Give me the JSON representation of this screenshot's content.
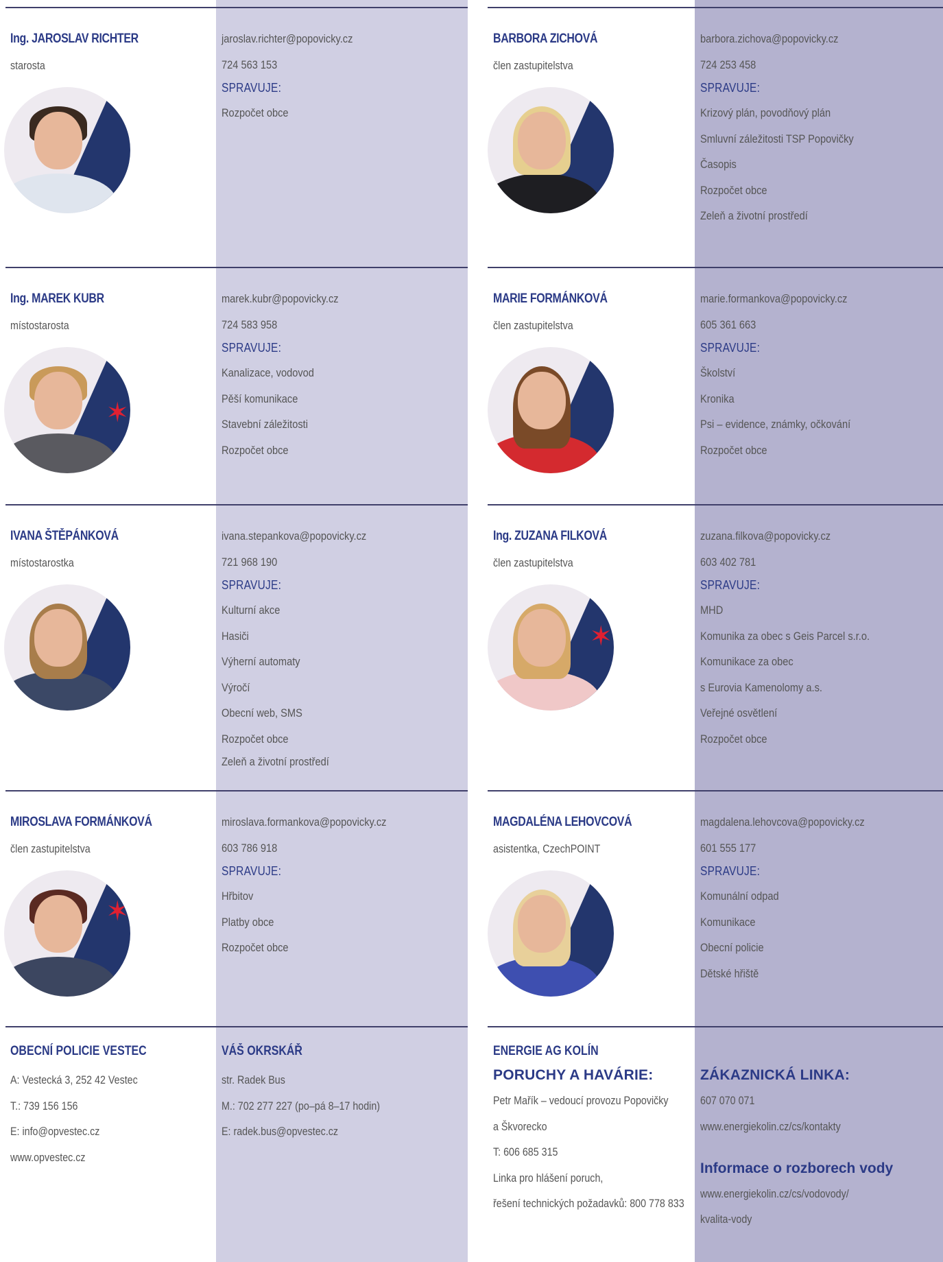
{
  "left_column": [
    {
      "name": "Ing. JAROSLAV RICHTER",
      "role": "starosta",
      "email": "jaroslav.richter@popovicky.cz",
      "phone": "724 563 153",
      "manages_label": "SPRAVUJE:",
      "manages": [
        "Rozpočet obce"
      ]
    },
    {
      "name": "Ing. MAREK KUBR",
      "role": "místostarosta",
      "email": "marek.kubr@popovicky.cz",
      "phone": "724 583 958",
      "manages_label": "SPRAVUJE:",
      "manages": [
        "Kanalizace, vodovod",
        "Pěší komunikace",
        "Stavební záležitosti",
        "Rozpočet obce"
      ]
    },
    {
      "name": "IVANA ŠTĚPÁNKOVÁ",
      "role": "místostarostka",
      "email": "ivana.stepankova@popovicky.cz",
      "phone": "721 968 190",
      "manages_label": "SPRAVUJE:",
      "manages": [
        "Kulturní akce",
        "Hasiči",
        "Výherní automaty",
        "Výročí",
        "Obecní web, SMS",
        "Rozpočet obce",
        "Zeleň a životní prostředí"
      ]
    },
    {
      "name": "MIROSLAVA FORMÁNKOVÁ",
      "role": "člen zastupitelstva",
      "email": "miroslava.formankova@popovicky.cz",
      "phone": "603 786 918",
      "manages_label": "SPRAVUJE:",
      "manages": [
        "Hřbitov",
        "Platby obce",
        "Rozpočet obce"
      ]
    }
  ],
  "right_column": [
    {
      "name": "BARBORA ZICHOVÁ",
      "role": "člen zastupitelstva",
      "email": "barbora.zichova@popovicky.cz",
      "phone": "724 253 458",
      "manages_label": "SPRAVUJE:",
      "manages": [
        "Krizový plán, povodňový plán",
        "Smluvní záležitosti TSP Popovičky",
        "Časopis",
        "Rozpočet obce",
        "Zeleň a životní prostředí"
      ]
    },
    {
      "name": "MARIE FORMÁNKOVÁ",
      "role": "člen zastupitelstva",
      "email": "marie.formankova@popovicky.cz",
      "phone": "605 361 663",
      "manages_label": "SPRAVUJE:",
      "manages": [
        "Školství",
        "Kronika",
        "Psi – evidence, známky, očkování",
        "Rozpočet obce"
      ]
    },
    {
      "name": "Ing. ZUZANA FILKOVÁ",
      "role": "člen zastupitelstva",
      "email": "zuzana.filkova@popovicky.cz",
      "phone": "603 402 781",
      "manages_label": "SPRAVUJE:",
      "manages": [
        "MHD",
        "Komunika za obec s Geis Parcel s.r.o.",
        "Komunikace za obec",
        "s Eurovia Kamenolomy a.s.",
        "Veřejné osvětlení",
        "Rozpočet obce"
      ]
    },
    {
      "name": "MAGDALÉNA LEHOVCOVÁ",
      "role": "asistentka, CzechPOINT",
      "email": "magdalena.lehovcova@popovicky.cz",
      "phone": "601 555 177",
      "manages_label": "SPRAVUJE:",
      "manages": [
        "Komunální odpad",
        "Komunikace",
        "Obecní policie",
        "Dětské hřiště"
      ]
    }
  ],
  "footer": {
    "police": {
      "title": "OBECNÍ POLICIE VESTEC",
      "lines": [
        "A: Vestecká 3, 252 42 Vestec",
        "T.: 739 156 156",
        "E: info@opvestec.cz",
        "www.opvestec.cz"
      ]
    },
    "officer": {
      "title": "VÁŠ OKRSKÁŘ",
      "lines": [
        "str. Radek Bus",
        "M.: 702 277 227 (po–pá 8–17 hodin)",
        "E: radek.bus@opvestec.cz"
      ]
    },
    "energy": {
      "title": "ENERGIE AG KOLÍN",
      "subtitle": "PORUCHY A HAVÁRIE:",
      "lines": [
        "Petr Mařík – vedoucí provozu Popovičky",
        "a Škvorecko",
        "T: 606 685 315",
        "Linka pro hlášení poruch,",
        "řešení technických požadavků: 800 778 833"
      ]
    },
    "customer": {
      "title": "ZÁKAZNICKÁ LINKA:",
      "lines": [
        "607 070 071",
        "www.energiekolin.cz/cs/kontakty"
      ],
      "info_title": "Informace o rozborech vody",
      "info_lines": [
        "www.energiekolin.cz/cs/vodovody/",
        "kvalita-vody"
      ]
    }
  }
}
